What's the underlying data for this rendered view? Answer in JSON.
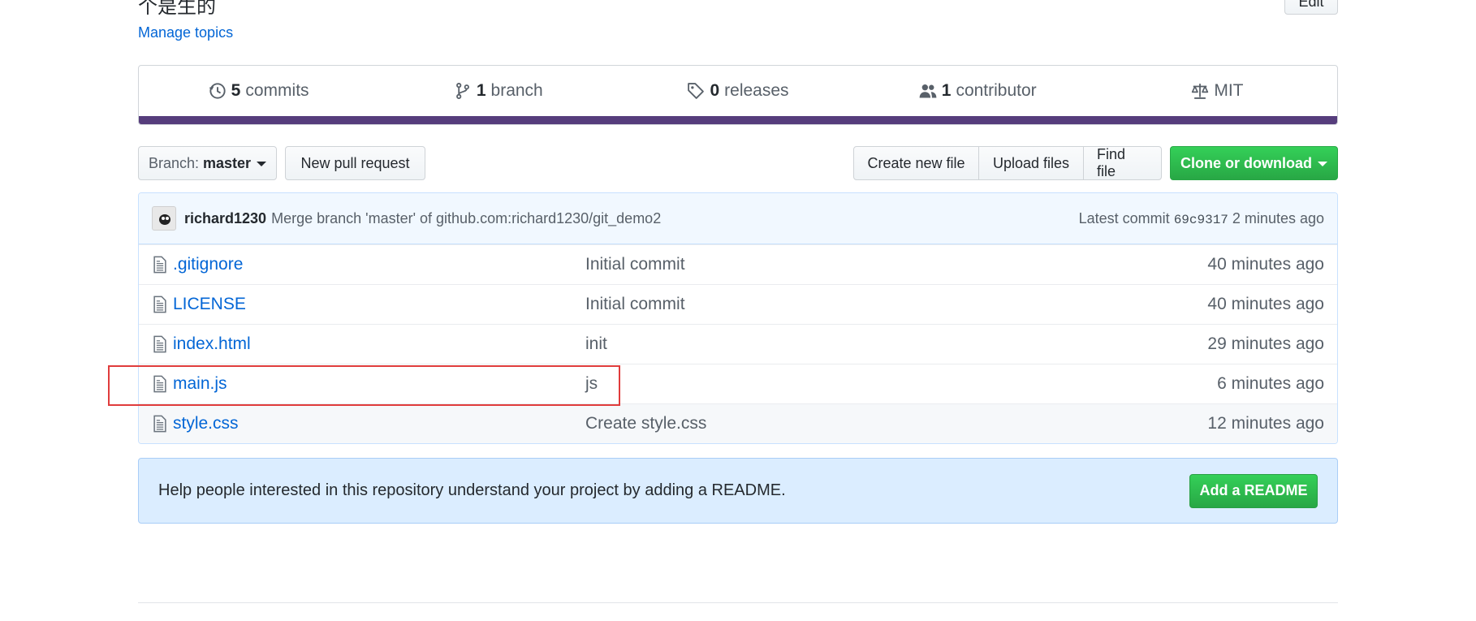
{
  "header": {
    "description_fragment": "个是生的",
    "edit_label": "Edit",
    "manage_topics": "Manage topics"
  },
  "summary": {
    "commits": {
      "count": "5",
      "label": "commits",
      "icon": "history-icon"
    },
    "branches": {
      "count": "1",
      "label": "branch",
      "icon": "branch-icon"
    },
    "releases": {
      "count": "0",
      "label": "releases",
      "icon": "tag-icon"
    },
    "contributors": {
      "count": "1",
      "label": "contributor",
      "icon": "people-icon"
    },
    "license": {
      "label": "MIT",
      "icon": "law-icon"
    },
    "language_color": "#563d7c"
  },
  "toolbar": {
    "branch_prefix": "Branch:",
    "branch_value": "master",
    "new_pull_request": "New pull request",
    "create_new_file": "Create new file",
    "upload_files": "Upload files",
    "find_file": "Find file",
    "clone_or_download": "Clone or download"
  },
  "commit": {
    "author": "richard1230",
    "message": "Merge branch 'master' of github.com:richard1230/git_demo2",
    "latest_label": "Latest commit",
    "sha": "69c9317",
    "age": "2 minutes ago"
  },
  "files": [
    {
      "name": ".gitignore",
      "message": "Initial commit",
      "age": "40 minutes ago"
    },
    {
      "name": "LICENSE",
      "message": "Initial commit",
      "age": "40 minutes ago"
    },
    {
      "name": "index.html",
      "message": "init",
      "age": "29 minutes ago"
    },
    {
      "name": "main.js",
      "message": "js",
      "age": "6 minutes ago"
    },
    {
      "name": "style.css",
      "message": "Create style.css",
      "age": "12 minutes ago"
    }
  ],
  "readme": {
    "text": "Help people interested in this repository understand your project by adding a README.",
    "button": "Add a README"
  },
  "colors": {
    "link": "#0366d6",
    "primary_green": "#28a745",
    "highlight_red": "#e03c3c"
  }
}
